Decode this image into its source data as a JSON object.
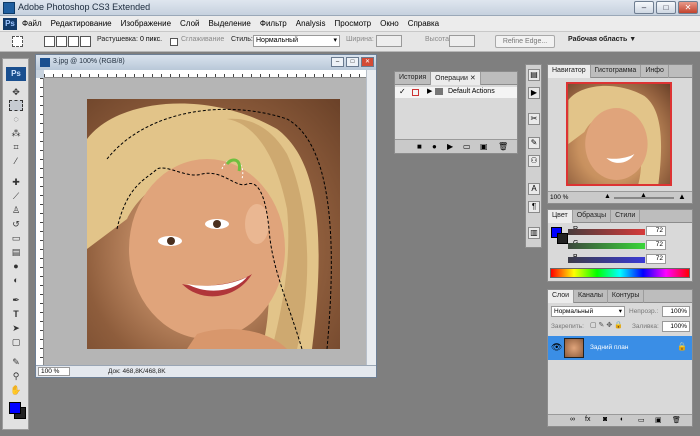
{
  "window": {
    "title": "Adobe Photoshop CS3 Extended",
    "min": "–",
    "max": "□",
    "close": "✕"
  },
  "menu": {
    "logo": "Ps",
    "items": [
      "Файл",
      "Редактирование",
      "Изображение",
      "Слой",
      "Выделение",
      "Фильтр",
      "Analysis",
      "Просмотр",
      "Окно",
      "Справка"
    ]
  },
  "options": {
    "feather_label": "Растушевка:",
    "feather_value": "0 пикс.",
    "smoothing_label": "Сглаживание",
    "style_label": "Стиль:",
    "style_value": "Нормальный",
    "width_label": "Ширина:",
    "height_label": "Высота:",
    "refine_label": "Refine Edge...",
    "workspace_label": "Рабочая область ▼"
  },
  "tools": {
    "badge": "Ps"
  },
  "colors": {
    "foreground": "#0000ff",
    "background": "#222222",
    "layer_selected": "#3a8ee6"
  },
  "document": {
    "title": "3.jpg @ 100% (RGB/8)",
    "zoom": "100 %",
    "doc_size": "Док: 468,8K/468,8K",
    "min": "–",
    "max": "□",
    "close": "✕"
  },
  "actions_panel": {
    "tabs": [
      "История",
      "Операции"
    ],
    "close": "✕",
    "item": "Default Actions"
  },
  "navigator": {
    "tabs": [
      "Навигатор",
      "Гистограмма",
      "Инфо"
    ],
    "zoom": "100 %"
  },
  "color_panel": {
    "tabs": [
      "Цвет",
      "Образцы",
      "Стили"
    ],
    "channels": [
      {
        "name": "R",
        "value": "72"
      },
      {
        "name": "G",
        "value": "72"
      },
      {
        "name": "B",
        "value": "72"
      }
    ]
  },
  "layers": {
    "tabs": [
      "Слои",
      "Каналы",
      "Контуры"
    ],
    "blend_mode": "Нормальный",
    "opacity_label": "Непрозр.:",
    "opacity_value": "100%",
    "lock_label": "Закрепить:",
    "fill_label": "Заливка:",
    "fill_value": "100%",
    "layer_name": "Задний план"
  }
}
